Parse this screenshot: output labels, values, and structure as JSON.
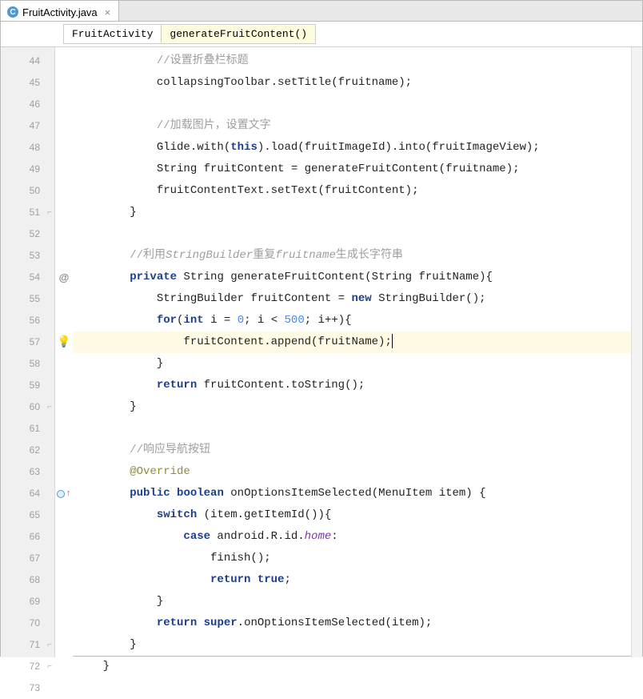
{
  "tab": {
    "filename": "FruitActivity.java",
    "icon_letter": "C"
  },
  "breadcrumbs": {
    "class": "FruitActivity",
    "method": "generateFruitContent()"
  },
  "gutter": {
    "start": 44,
    "end": 73,
    "override_marker_at": 64,
    "at_marker_at": 54,
    "bulb_at": 57,
    "fold_ends": [
      51,
      60,
      71,
      72
    ],
    "highlight_line": 57
  },
  "code": {
    "l44": "            //设置折叠栏标题",
    "l45_a": "            collapsingToolbar.setTitle(fruitname);",
    "l46": "",
    "l47": "            //加载图片，设置文字",
    "l48_pre": "            Glide.with(",
    "l48_kw": "this",
    "l48_post": ").load(fruitImageId).into(fruitImageView);",
    "l49": "            String fruitContent = generateFruitContent(fruitname);",
    "l50": "            fruitContentText.setText(fruitContent);",
    "l51": "        }",
    "l52": "",
    "l53_pre": "        //利用",
    "l53_it1": "StringBuilder",
    "l53_mid": "重复",
    "l53_it2": "fruitname",
    "l53_post": "生成长字符串",
    "l54_kw1": "private",
    "l54_mid": " String generateFruitContent(String fruitName){",
    "l55_pre": "            StringBuilder fruitContent = ",
    "l55_kw": "new",
    "l55_post": " StringBuilder();",
    "l56_kw1": "for",
    "l56_p1": "(",
    "l56_kw2": "int",
    "l56_p2": " i = ",
    "l56_n1": "0",
    "l56_p3": "; i < ",
    "l56_n2": "500",
    "l56_p4": "; i++){",
    "l57": "                fruitContent.append(fruitName);",
    "l58": "            }",
    "l59_kw": "return",
    "l59_post": " fruitContent.toString();",
    "l60": "        }",
    "l61": "",
    "l62": "        //响应导航按钮",
    "l63": "@Override",
    "l64_kw1": "public",
    "l64_kw2": "boolean",
    "l64_post": " onOptionsItemSelected(MenuItem item) {",
    "l65_kw": "switch",
    "l65_post": " (item.getItemId()){",
    "l66_kw": "case",
    "l66_mid": " android.R.id.",
    "l66_it": "home",
    "l66_post": ":",
    "l67": "                    finish();",
    "l68_kw": "return true",
    "l68_post": ";",
    "l69": "            }",
    "l70_kw1": "return",
    "l70_kw2": "super",
    "l70_post": ".onOptionsItemSelected(item);",
    "l71": "        }",
    "l72": "    }",
    "l73": ""
  }
}
